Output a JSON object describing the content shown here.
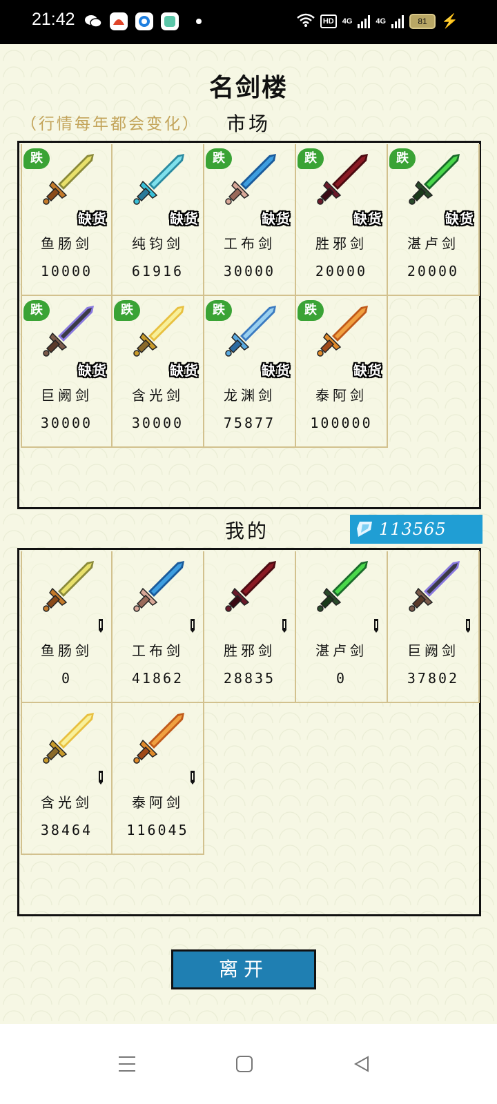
{
  "status_bar": {
    "time": "21:42",
    "hd_label": "HD",
    "net1": "4G",
    "net2": "4G",
    "battery": "81"
  },
  "page": {
    "title": "名剑楼",
    "note": "（行情每年都会变化）",
    "market_label": "市场",
    "mine_label": "我的",
    "gem_count": "113565",
    "leave_button": "离开",
    "badge_drop": "跌",
    "badge_out_of_stock": "缺货"
  },
  "colors": {
    "accent": "#209ed4",
    "button": "#1f7fb2",
    "drop_badge": "#3aa335",
    "note_text": "#c3a45a",
    "cell_border": "#d2c18e"
  },
  "market": [
    {
      "name": "鱼肠剑",
      "price": "10000",
      "drop": true,
      "out_of_stock": true,
      "sword": "yellow-sword-icon"
    },
    {
      "name": "纯钧剑",
      "price": "61916",
      "drop": false,
      "out_of_stock": true,
      "sword": "cyan-sword-icon"
    },
    {
      "name": "工布剑",
      "price": "30000",
      "drop": true,
      "out_of_stock": true,
      "sword": "blue-sword-icon"
    },
    {
      "name": "胜邪剑",
      "price": "20000",
      "drop": true,
      "out_of_stock": true,
      "sword": "crimson-sword-icon"
    },
    {
      "name": "湛卢剑",
      "price": "20000",
      "drop": true,
      "out_of_stock": true,
      "sword": "green-sword-icon"
    },
    {
      "name": "巨阙剑",
      "price": "30000",
      "drop": true,
      "out_of_stock": true,
      "sword": "dark-sword-icon"
    },
    {
      "name": "含光剑",
      "price": "30000",
      "drop": true,
      "out_of_stock": true,
      "sword": "gold-sword-icon"
    },
    {
      "name": "龙渊剑",
      "price": "75877",
      "drop": true,
      "out_of_stock": true,
      "sword": "ice-sword-icon"
    },
    {
      "name": "泰阿剑",
      "price": "100000",
      "drop": true,
      "out_of_stock": true,
      "sword": "orange-sword-icon"
    }
  ],
  "mine": [
    {
      "name": "鱼肠剑",
      "value": "0",
      "sword": "yellow-sword-icon"
    },
    {
      "name": "工布剑",
      "value": "41862",
      "sword": "blue-sword-icon"
    },
    {
      "name": "胜邪剑",
      "value": "28835",
      "sword": "crimson-sword-icon"
    },
    {
      "name": "湛卢剑",
      "value": "0",
      "sword": "green-sword-icon"
    },
    {
      "name": "巨阙剑",
      "value": "37802",
      "sword": "dark-sword-icon"
    },
    {
      "name": "含光剑",
      "value": "38464",
      "sword": "gold-sword-icon"
    },
    {
      "name": "泰阿剑",
      "value": "116045",
      "sword": "orange-sword-icon"
    }
  ]
}
